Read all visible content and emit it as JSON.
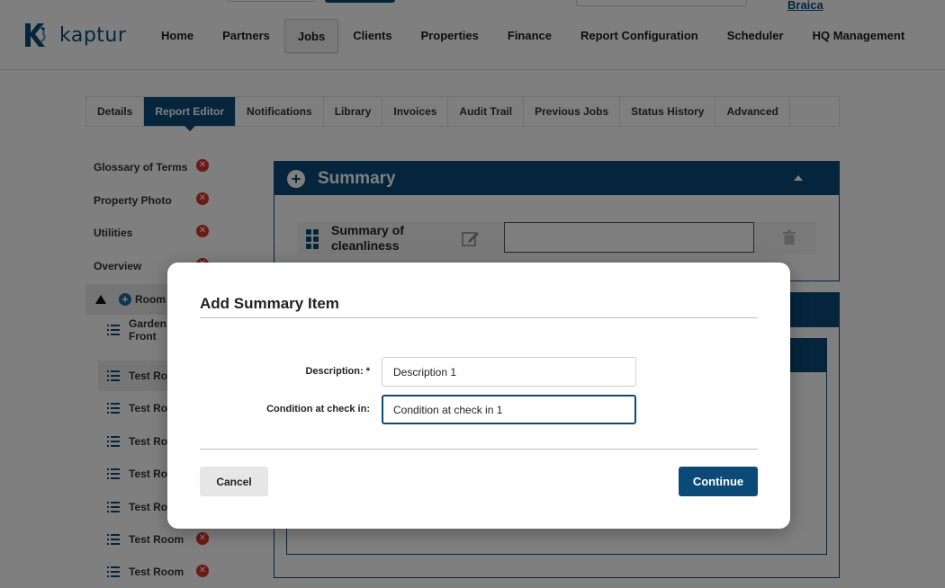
{
  "header": {
    "user_link": "Braica",
    "logo_text": "kaptur",
    "nav": [
      "Home",
      "Partners",
      "Jobs",
      "Clients",
      "Properties",
      "Finance",
      "Report Configuration",
      "Scheduler",
      "HQ Management"
    ],
    "active_nav": "Jobs"
  },
  "subtabs": {
    "items": [
      "Details",
      "Report Editor",
      "Notifications",
      "Library",
      "Invoices",
      "Audit Trail",
      "Previous Jobs",
      "Status History",
      "Advanced"
    ],
    "active": "Report Editor"
  },
  "sidebar": {
    "items": [
      "Glossary of Terms",
      "Property Photo",
      "Utilities",
      "Overview"
    ],
    "room_header": "Rooms",
    "room_header_visible": "Room",
    "rooms": [
      {
        "line1": "Garden",
        "line2": "Front"
      },
      {
        "line1": "Test Ro"
      },
      {
        "line1": "Test Ro"
      },
      {
        "line1": "Test Ro"
      },
      {
        "line1": "Test Ro"
      },
      {
        "line1": "Test Ro"
      },
      {
        "line1": "Test Room"
      },
      {
        "line1": "Test Room"
      }
    ]
  },
  "main": {
    "panel_title": "Summary",
    "summary_row_label": "Summary of cleanliness",
    "summary_row_value": ""
  },
  "modal": {
    "title": "Add Summary Item",
    "description_label": "Description: *",
    "description_value": "Description 1",
    "condition_label": "Condition at check in:",
    "condition_value": "Condition at check in 1",
    "cancel_label": "Cancel",
    "continue_label": "Continue"
  },
  "colors": {
    "brand": "#0b4a78",
    "danger": "#d9342b",
    "overlay": "rgba(0,0,0,0.5)"
  },
  "icons": [
    "kaptur-logo",
    "x-circle-icon",
    "triangle-up-icon",
    "plus-circle-icon",
    "list-icon",
    "grip-icon",
    "edit-icon",
    "trash-icon",
    "caret-up-icon"
  ]
}
